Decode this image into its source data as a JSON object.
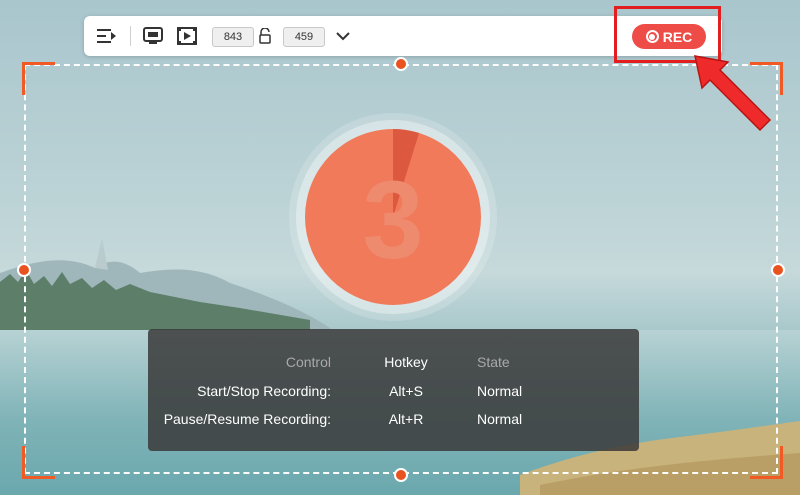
{
  "toolbar": {
    "width_value": "843",
    "height_value": "459",
    "rec_label": "REC",
    "icons": [
      "panel-toggle-icon",
      "fullscreen-icon",
      "region-select-icon",
      "lock-ratio-icon",
      "chevron-down-icon",
      "record-icon"
    ]
  },
  "countdown": {
    "value": "3"
  },
  "hotkeys": {
    "headers": {
      "control": "Control",
      "hotkey": "Hotkey",
      "state": "State"
    },
    "rows": [
      {
        "control": "Start/Stop Recording:",
        "hotkey": "Alt+S",
        "state": "Normal"
      },
      {
        "control": "Pause/Resume Recording:",
        "hotkey": "Alt+R",
        "state": "Normal"
      }
    ]
  },
  "colors": {
    "accent": "#f05a24",
    "rec_button": "#ee4c47",
    "highlight_box": "#e31e1e",
    "countdown_fill": "#f07a5a"
  }
}
